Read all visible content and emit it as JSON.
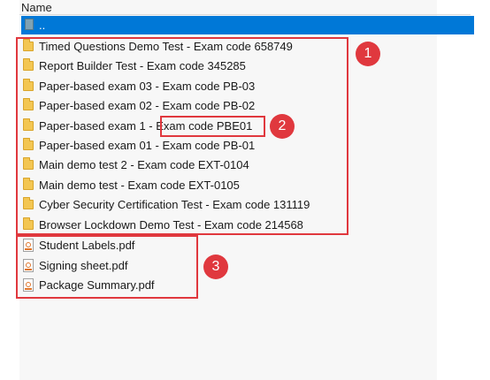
{
  "header": {
    "name_column": "Name"
  },
  "parent": {
    "label": ".."
  },
  "folders": [
    {
      "label": "Timed Questions Demo Test - Exam code 658749"
    },
    {
      "label": "Report Builder Test - Exam code 345285"
    },
    {
      "label": "Paper-based exam 03 - Exam code PB-03"
    },
    {
      "label": "Paper-based exam 02 - Exam code PB-02"
    },
    {
      "label": "Paper-based exam 1 - Exam code PBE01"
    },
    {
      "label": "Paper-based exam 01 - Exam code PB-01"
    },
    {
      "label": "Main demo test 2 - Exam code EXT-0104"
    },
    {
      "label": "Main demo test  - Exam code EXT-0105"
    },
    {
      "label": "Cyber Security Certification Test - Exam code 131119"
    },
    {
      "label": "Browser Lockdown Demo Test - Exam code 214568"
    }
  ],
  "files": [
    {
      "label": "Student Labels.pdf",
      "icon": "pdf-icon"
    },
    {
      "label": "Signing sheet.pdf",
      "icon": "pdf-icon"
    },
    {
      "label": "Package Summary.pdf",
      "icon": "pdf-icon"
    }
  ],
  "callouts": {
    "one": "1",
    "two": "2",
    "three": "3"
  },
  "colors": {
    "selection": "#0078d7",
    "highlight": "#e0383e",
    "folder": "#f3c652"
  }
}
